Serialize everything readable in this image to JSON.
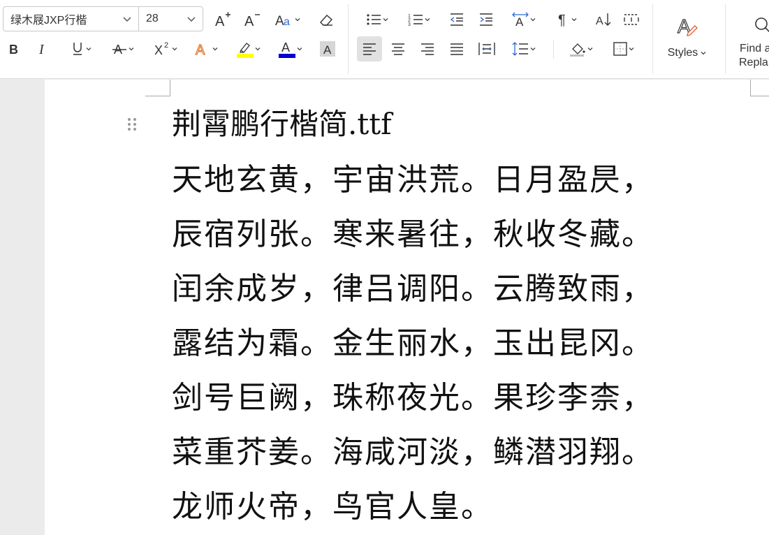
{
  "toolbar": {
    "font_name": "绿木屐JXP行楷",
    "font_size": "28",
    "styles_label": "Styles",
    "find_label_line1": "Find a",
    "find_label_line2": "Repla",
    "highlight_color": "#ffff00",
    "font_color": "#0000d0"
  },
  "document": {
    "title": "荆霄鹏行楷简.ttf",
    "lines": [
      "天地玄黄，宇宙洪荒。日月盈昃，",
      "辰宿列张。寒来暑往，秋收冬藏。",
      "闰余成岁，律吕调阳。云腾致雨，",
      "露结为霜。金生丽水，玉出昆冈。",
      "剑号巨阙，珠称夜光。果珍李柰，",
      "菜重芥姜。海咸河淡，鳞潜羽翔。",
      "龙师火帝，鸟官人皇。"
    ]
  }
}
